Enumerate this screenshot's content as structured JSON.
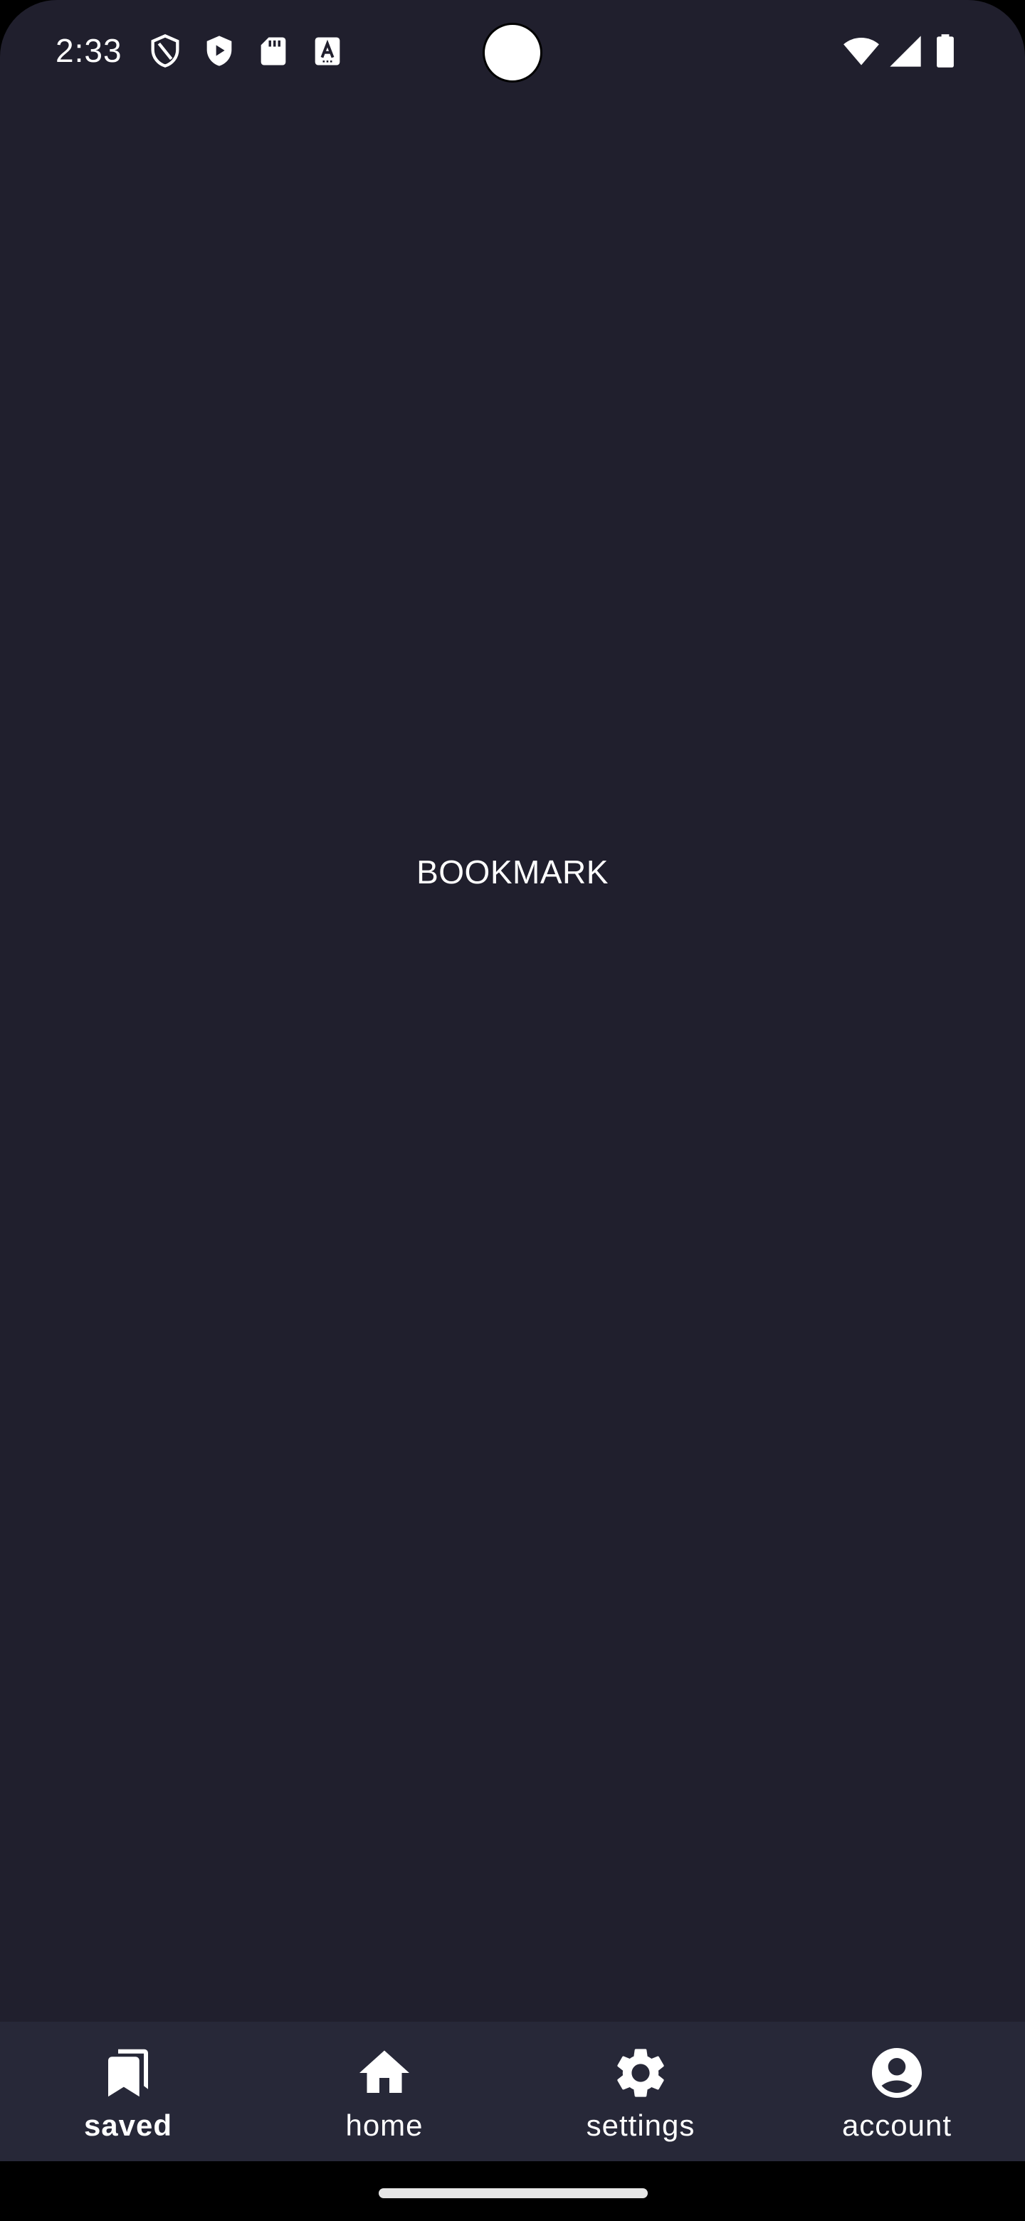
{
  "status_bar": {
    "time": "2:33",
    "left_icons": [
      "shield-outline-icon",
      "play-shield-icon",
      "sd-card-icon",
      "font-a-icon"
    ],
    "right_icons": [
      "wifi-icon",
      "cellular-signal-icon",
      "battery-icon"
    ]
  },
  "content": {
    "label": "BOOKMARK"
  },
  "bottom_nav": {
    "items": [
      {
        "label": "saved",
        "icon": "bookmarks-icon",
        "active": true
      },
      {
        "label": "home",
        "icon": "home-icon",
        "active": false
      },
      {
        "label": "settings",
        "icon": "gear-icon",
        "active": false
      },
      {
        "label": "account",
        "icon": "account-circle-icon",
        "active": false
      }
    ]
  },
  "colors": {
    "background": "#201f2d",
    "nav_background": "#272838",
    "text": "#ffffff"
  }
}
